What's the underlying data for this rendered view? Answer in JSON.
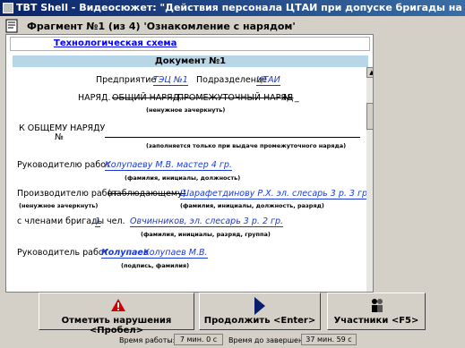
{
  "window": {
    "title": "TBT Shell - Видеосюжет: \"Действия персонала ЦТАИ при допуске бригады на проведение текущего ремонта эл. схемы\""
  },
  "fragment": {
    "title": "Фрагмент №1 (из 4) 'Ознакомление с нарядом'"
  },
  "tech_scheme": {
    "label": "Технологическая схема"
  },
  "document": {
    "header": "Документ №1",
    "enterprise_label": "Предприятие",
    "enterprise_value": "ТЭЦ №1",
    "division_label": "Подразделение",
    "division_value": "ЦТАИ",
    "order_label": "НАРЯД.",
    "order_general": "ОБЩИЙ НАРЯД.",
    "order_intermediate": "ПРОМЕЖУТОЧНЫЙ НАРЯД",
    "order_no": "№ _",
    "note_strike": "(ненужное зачеркнуть)",
    "general_order_line1": "К ОБЩЕМУ НАРЯДУ",
    "general_order_line2": "№",
    "note_intermediate_only": "(заполняется только при выдаче промежуточного наряда)",
    "work_manager_label": "Руководителю работ",
    "work_manager_value": "Колупаеву М.В. мастер 4 гр.",
    "note_name_initials_position": "(фамилия, инициалы, должность)",
    "performer_label": "Производителю работ",
    "observer_label": "(наблюдающему)",
    "performer_value": "Шарафетдинову Р.Х. эл. слесарь 3 р. 3 гр.",
    "note_strike2": "(ненужное зачеркнуть)",
    "note_name_initials_position_rank": "(фамилия, инициалы, должность, разряд)",
    "members_label": "с членами бригады",
    "members_count": "1",
    "members_unit": "чел.",
    "members_value": "Овчинников, эл. слесарь 3 р. 2 гр.",
    "note_members": "(фамилия, инициалы, разряд, группа)",
    "manager_sign_label": "Руководитель работ",
    "manager_signature": "Колупаев",
    "manager_sign_value": "Колупаев М.В.",
    "note_signature": "(подпись, фамилия)"
  },
  "buttons": {
    "mark_violation": "Отметить нарушения <Пробел>",
    "continue": "Продолжить <Enter>",
    "participants": "Участники <F5>"
  },
  "status": {
    "work_time_label": "Время работы:",
    "work_time_value": "7 мин. 0 с",
    "remaining_label": "Время до завершения:",
    "remaining_value": "37 мин. 59 с"
  },
  "colors": {
    "title_bar": "#0a246a",
    "doc_header": "#b7d7e8",
    "link_blue": "#0000ff",
    "filled_blue": "#1a3ad8",
    "warning_red": "#d40000",
    "continue_navy": "#0a1f6b"
  }
}
